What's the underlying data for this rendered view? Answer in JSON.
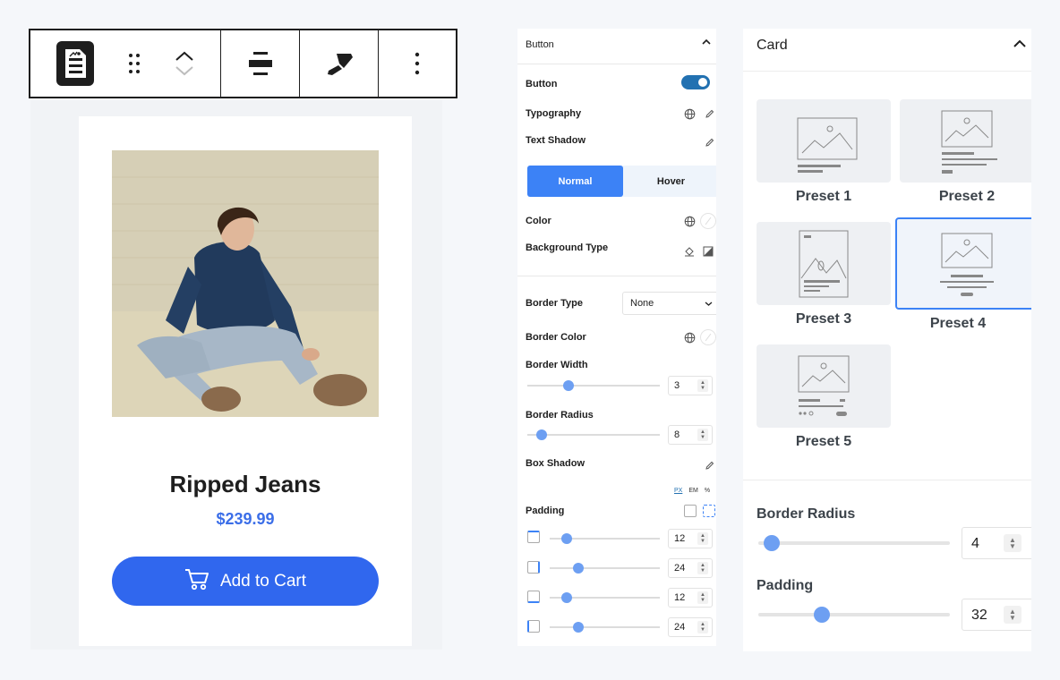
{
  "toolbar": {
    "icons": [
      "post-block-icon",
      "drag-handle-icon",
      "move-up-icon",
      "move-down-icon",
      "align-center-icon",
      "paint-brush-icon",
      "more-options-icon"
    ]
  },
  "product_card": {
    "title": "Ripped Jeans",
    "price": "$239.99",
    "button_label": "Add to Cart",
    "accent_color": "#3067ee"
  },
  "button_panel": {
    "header": "Button",
    "button_label": "Button",
    "button_enabled": true,
    "typography_label": "Typography",
    "text_shadow_label": "Text Shadow",
    "state_tabs": [
      {
        "label": "Normal",
        "active": true
      },
      {
        "label": "Hover",
        "active": false
      }
    ],
    "color_label": "Color",
    "background_type_label": "Background Type",
    "border_type_label": "Border Type",
    "border_type_value": "None",
    "border_color_label": "Border Color",
    "border_width_label": "Border Width",
    "border_width_value": "3",
    "border_radius_label": "Border Radius",
    "border_radius_value": "8",
    "box_shadow_label": "Box Shadow",
    "units": [
      {
        "label": "PX",
        "active": true
      },
      {
        "label": "EM",
        "active": false
      },
      {
        "label": "%",
        "active": false
      }
    ],
    "padding_label": "Padding",
    "padding_values": [
      "12",
      "24",
      "12",
      "24"
    ]
  },
  "card_panel": {
    "header": "Card",
    "presets": [
      {
        "name": "Preset 1",
        "selected": false
      },
      {
        "name": "Preset 2",
        "selected": false
      },
      {
        "name": "Preset 3",
        "selected": false
      },
      {
        "name": "Preset 4",
        "selected": true
      },
      {
        "name": "Preset 5",
        "selected": false
      }
    ],
    "border_radius_label": "Border Radius",
    "border_radius_value": "4",
    "padding_label": "Padding",
    "padding_value": "32"
  }
}
